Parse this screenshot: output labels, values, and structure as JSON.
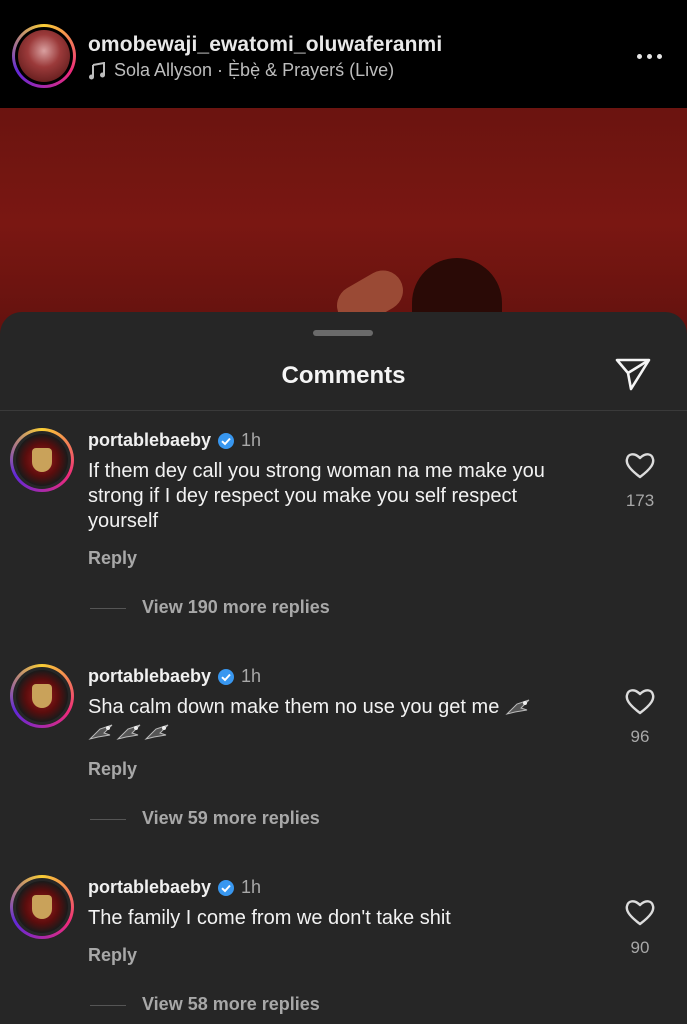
{
  "post": {
    "username": "omobewaji_ewatomi_oluwaferanmi",
    "music": "Sola Allyson · Ẹ̀bẹ̀ & Prayerś (Live)"
  },
  "sheet": {
    "title": "Comments"
  },
  "comments": [
    {
      "user": "portablebaeby",
      "time": "1h",
      "text": "If them dey call you strong woman na me make you strong if I dey respect you make you self respect yourself",
      "reply_label": "Reply",
      "more_replies": "View 190 more replies",
      "likes": "173"
    },
    {
      "user": "portablebaeby",
      "time": "1h",
      "text": "Sha calm down make them no use you get me",
      "reply_label": "Reply",
      "more_replies": "View 59 more replies",
      "likes": "96"
    },
    {
      "user": "portablebaeby",
      "time": "1h",
      "text": "The family I come from we don't take shit",
      "reply_label": "Reply",
      "more_replies": "View 58 more replies",
      "likes": "90"
    }
  ],
  "icons": {
    "verified_color": "#3897f0",
    "story_ring": "gradient"
  }
}
